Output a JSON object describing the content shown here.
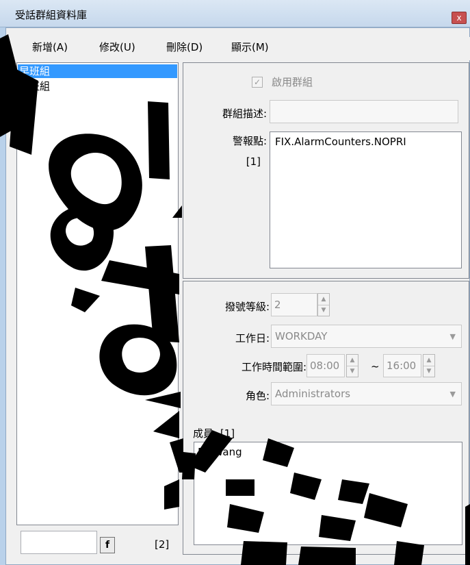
{
  "window": {
    "title": "受話群組資料庫",
    "close_label": "x"
  },
  "menu": [
    {
      "label": "新增(A)"
    },
    {
      "label": "修改(U)"
    },
    {
      "label": "刪除(D)"
    },
    {
      "label": "顯示(M)"
    }
  ],
  "groups": [
    {
      "name": "早班組",
      "selected": true
    },
    {
      "name": "晚班組",
      "selected": false
    }
  ],
  "group_list_footer": {
    "find_value": "",
    "find_button": "f",
    "count": "[2]"
  },
  "group_settings": {
    "enable_label": "啟用群組",
    "enable_checked": true,
    "desc_label": "群組描述:",
    "desc_value": "",
    "alarm_label": "警報點:",
    "alarm_count": "[1]",
    "alarm_points": [
      "FIX.AlarmCounters.NOPRI"
    ]
  },
  "dial_settings": {
    "level_label": "撥號等級:",
    "level_value": "2",
    "workday_label": "工作日:",
    "workday_value": "WORKDAY",
    "time_label": "工作時間範圍:",
    "time_start": "08:00",
    "time_sep": "~",
    "time_end": "16:00",
    "role_label": "角色:",
    "role_value": "Administrators",
    "members_label": "成員: [1]",
    "members": [
      "Mr.Wang"
    ]
  },
  "watermark": {
    "color": "#000000"
  }
}
